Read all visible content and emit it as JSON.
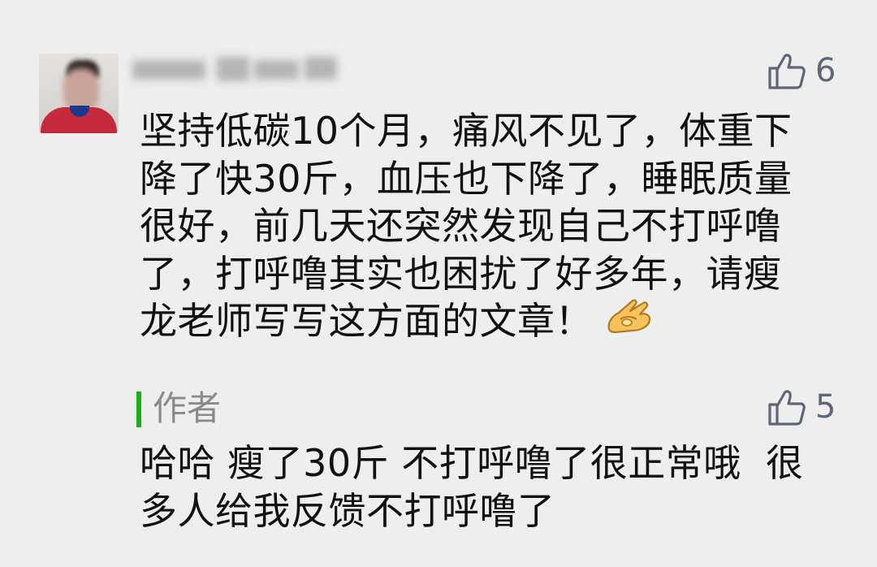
{
  "comment": {
    "author_name": "",
    "likes": "6",
    "text_lines": [
      "坚持低碳10个月，痛风不见了，体重下",
      "降了快30斤，血压也下降了，睡眠质量",
      "很好，前几天还突然发现自己不打呼噜",
      "了，打呼噜其实也困扰了好多年，请瘦",
      "龙老师写写这方面的文章！"
    ],
    "emoji": "ok-hand-emoji"
  },
  "reply": {
    "label": "作者",
    "likes": "5",
    "text_lines": [
      "哈哈 瘦了30斤 不打呼噜了很正常哦  很",
      "多人给我反馈不打呼噜了"
    ]
  },
  "colors": {
    "background": "#eeeeee",
    "text": "#111111",
    "like": "#5d6778",
    "author_accent": "#1aad19",
    "author_label": "#8a8a8a"
  },
  "icons": {
    "like": "thumbs-up-icon"
  }
}
